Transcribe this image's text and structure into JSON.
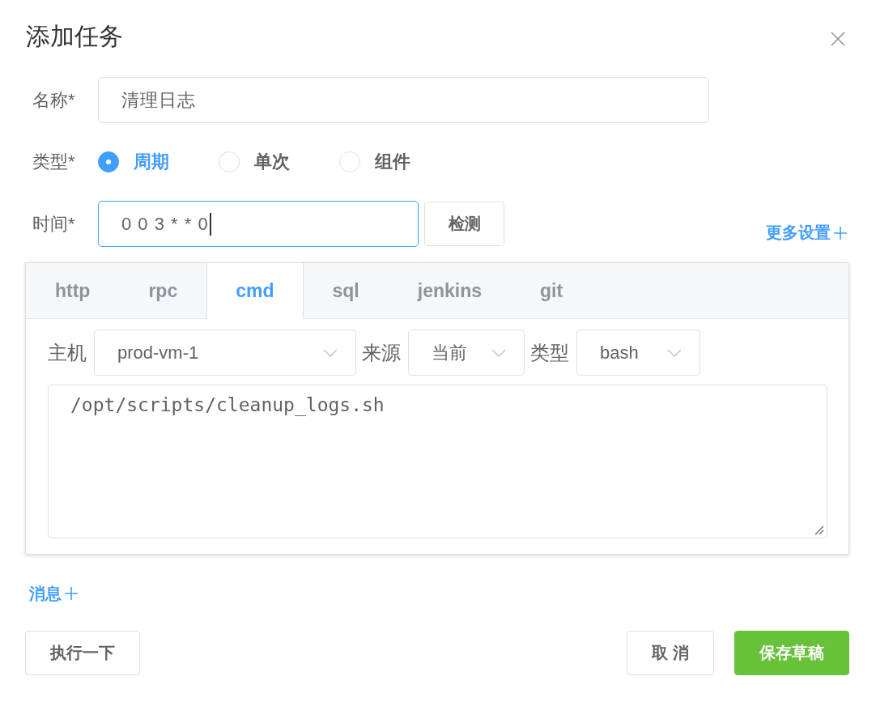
{
  "dialog": {
    "title": "添加任务"
  },
  "name_field": {
    "label": "名称*",
    "value": "清理日志",
    "focused": false
  },
  "type_field": {
    "label": "类型*",
    "options": [
      {
        "label": "周期",
        "selected": true
      },
      {
        "label": "单次",
        "selected": false
      },
      {
        "label": "组件",
        "selected": false
      }
    ]
  },
  "time_field": {
    "label": "时间*",
    "value": "0 0 3 * * 0",
    "focused": true,
    "button": "检测"
  },
  "more_settings_link": "更多设置",
  "tabs": [
    {
      "label": "http",
      "selected": false
    },
    {
      "label": "rpc",
      "selected": false
    },
    {
      "label": "cmd",
      "selected": true
    },
    {
      "label": "sql",
      "selected": false
    },
    {
      "label": "jenkins",
      "selected": false
    },
    {
      "label": "git",
      "selected": false
    }
  ],
  "cmd_panel": {
    "selects": [
      {
        "label": "主机",
        "value": "prod-vm-1"
      },
      {
        "label": "来源",
        "value": "当前"
      },
      {
        "label": "类型",
        "value": "bash"
      }
    ],
    "script": "/opt/scripts/cleanup_logs.sh"
  },
  "message_link": "消息",
  "footer": {
    "left_buttons": [
      {
        "label": "执行一下",
        "kind": "default"
      }
    ],
    "right_buttons": [
      {
        "label": "取 消",
        "kind": "default"
      },
      {
        "label": "保存草稿",
        "kind": "primary"
      }
    ]
  }
}
